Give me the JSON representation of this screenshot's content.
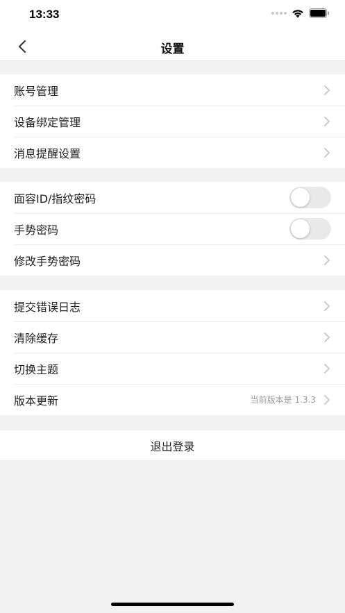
{
  "status_bar": {
    "time": "13:33"
  },
  "nav": {
    "title": "设置"
  },
  "groups": [
    {
      "rows": [
        {
          "label": "账号管理"
        },
        {
          "label": "设备绑定管理"
        },
        {
          "label": "消息提醒设置"
        }
      ]
    },
    {
      "rows": [
        {
          "label": "面容ID/指纹密码",
          "toggle": false
        },
        {
          "label": "手势密码",
          "toggle": false
        },
        {
          "label": "修改手势密码"
        }
      ]
    },
    {
      "rows": [
        {
          "label": "提交错误日志"
        },
        {
          "label": "清除缓存"
        },
        {
          "label": "切换主题"
        },
        {
          "label": "版本更新",
          "value": "当前版本是 1.3.3"
        }
      ]
    }
  ],
  "logout": {
    "label": "退出登录"
  },
  "icons": {
    "back": "chevron-left-icon",
    "row_arrow": "chevron-right-icon",
    "wifi": "wifi-icon",
    "battery": "battery-icon"
  },
  "colors": {
    "background": "#f2f2f2",
    "surface": "#ffffff",
    "chevron": "#c4c4c4",
    "toggle_off": "#e9e9ea"
  }
}
